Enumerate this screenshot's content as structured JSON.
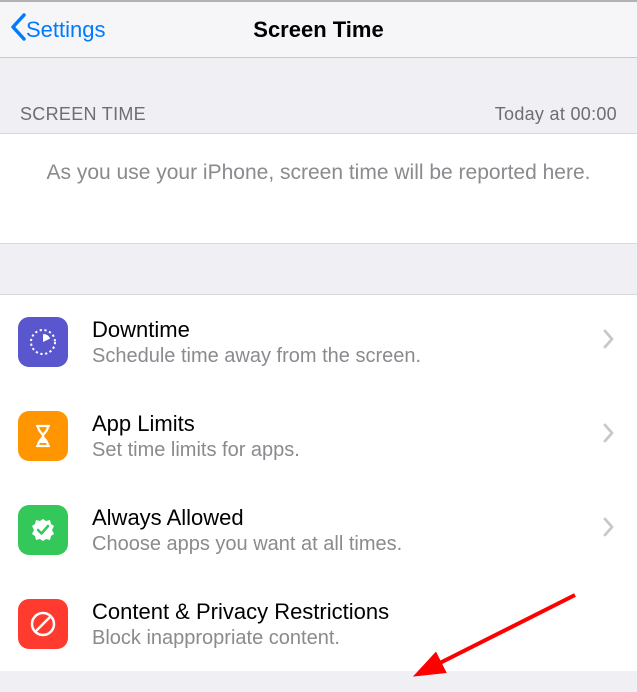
{
  "nav": {
    "back_label": "Settings",
    "title": "Screen Time"
  },
  "section": {
    "left": "SCREEN TIME",
    "right": "Today at 00:00"
  },
  "report_text": "As you use your iPhone, screen time will be reported here.",
  "rows": [
    {
      "title": "Downtime",
      "subtitle": "Schedule time away from the screen."
    },
    {
      "title": "App Limits",
      "subtitle": "Set time limits for apps."
    },
    {
      "title": "Always Allowed",
      "subtitle": "Choose apps you want at all times."
    },
    {
      "title": "Content & Privacy Restrictions",
      "subtitle": "Block inappropriate content."
    }
  ]
}
